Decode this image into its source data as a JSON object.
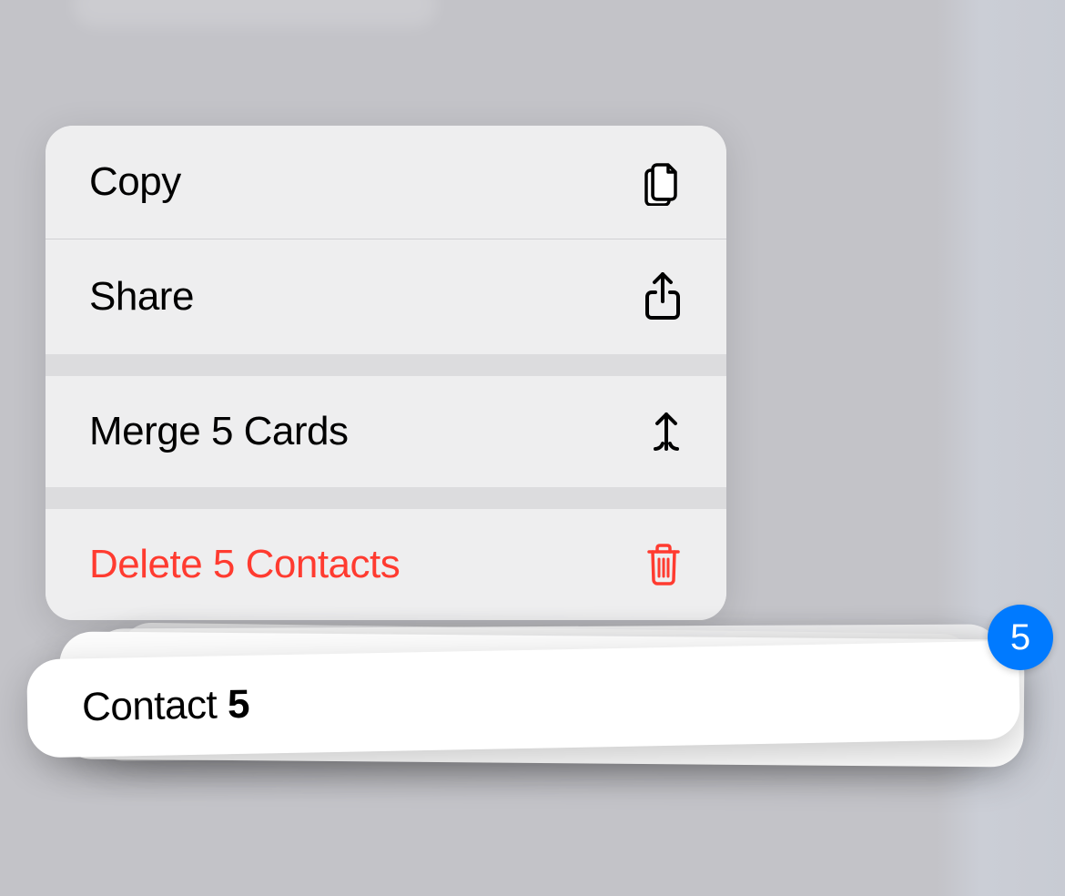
{
  "menu": {
    "copy": {
      "label": "Copy"
    },
    "share": {
      "label": "Share"
    },
    "merge": {
      "label": "Merge 5 Cards"
    },
    "delete": {
      "label": "Delete 5 Contacts"
    }
  },
  "contact": {
    "name_prefix": "Contact ",
    "name_bold": "5"
  },
  "badge": {
    "count": "5"
  },
  "colors": {
    "destructive": "#ff3b30",
    "accent": "#007aff"
  }
}
